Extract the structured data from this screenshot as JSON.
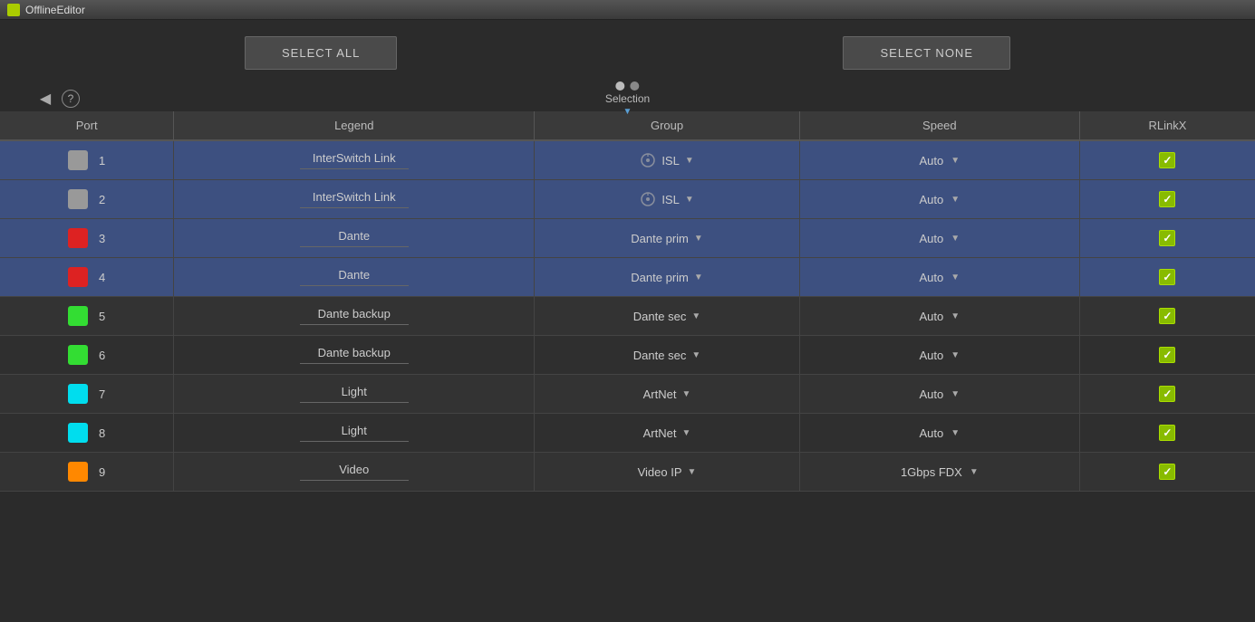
{
  "titlebar": {
    "title": "OfflineEditor",
    "icon_color": "#aacc00"
  },
  "buttons": {
    "select_all": "SELECT ALL",
    "select_none": "SELECT NONE"
  },
  "navigation": {
    "back_label": "◀",
    "help_label": "?",
    "selection_label": "Selection",
    "selection_arrow": "▼"
  },
  "table": {
    "headers": [
      "Port",
      "Legend",
      "Group",
      "Speed",
      "RLinkX"
    ],
    "rows": [
      {
        "id": 1,
        "color": "#999999",
        "number": "1",
        "legend": "InterSwitch Link",
        "group_icon": true,
        "group": "ISL",
        "speed": "Auto",
        "rlinkx": true,
        "selected": true
      },
      {
        "id": 2,
        "color": "#999999",
        "number": "2",
        "legend": "InterSwitch Link",
        "group_icon": true,
        "group": "ISL",
        "speed": "Auto",
        "rlinkx": true,
        "selected": true
      },
      {
        "id": 3,
        "color": "#dd2222",
        "number": "3",
        "legend": "Dante",
        "group_icon": false,
        "group": "Dante prim",
        "speed": "Auto",
        "rlinkx": true,
        "selected": true
      },
      {
        "id": 4,
        "color": "#dd2222",
        "number": "4",
        "legend": "Dante",
        "group_icon": false,
        "group": "Dante prim",
        "speed": "Auto",
        "rlinkx": true,
        "selected": true
      },
      {
        "id": 5,
        "color": "#33dd33",
        "number": "5",
        "legend": "Dante backup",
        "group_icon": false,
        "group": "Dante sec",
        "speed": "Auto",
        "rlinkx": true,
        "selected": false
      },
      {
        "id": 6,
        "color": "#33dd33",
        "number": "6",
        "legend": "Dante backup",
        "group_icon": false,
        "group": "Dante sec",
        "speed": "Auto",
        "rlinkx": true,
        "selected": false
      },
      {
        "id": 7,
        "color": "#00ddee",
        "number": "7",
        "legend": "Light",
        "group_icon": false,
        "group": "ArtNet",
        "speed": "Auto",
        "rlinkx": true,
        "selected": false
      },
      {
        "id": 8,
        "color": "#00ddee",
        "number": "8",
        "legend": "Light",
        "group_icon": false,
        "group": "ArtNet",
        "speed": "Auto",
        "rlinkx": true,
        "selected": false
      },
      {
        "id": 9,
        "color": "#ff8800",
        "number": "9",
        "legend": "Video",
        "group_icon": false,
        "group": "Video IP",
        "speed": "1Gbps FDX",
        "rlinkx": true,
        "selected": false
      }
    ]
  },
  "colors": {
    "selected_row_bg": "#3d5080",
    "normal_row_bg": "#333",
    "alt_row_bg": "#2f2f2f",
    "header_bg": "#3a3a3a"
  }
}
